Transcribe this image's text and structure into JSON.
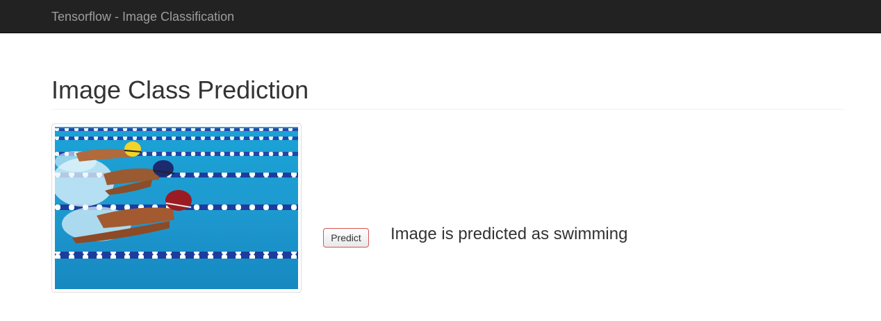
{
  "navbar": {
    "brand": "Tensorflow - Image Classification",
    "background": "#222222",
    "brand_color": "#9d9d9d"
  },
  "main": {
    "heading": "Image Class Prediction",
    "image": {
      "subject": "swimmers-butterfly-stroke-photo"
    },
    "predict_button": {
      "label": "Predict",
      "border_color": "#d9534f"
    },
    "result_text": "Image is predicted as swimming"
  }
}
